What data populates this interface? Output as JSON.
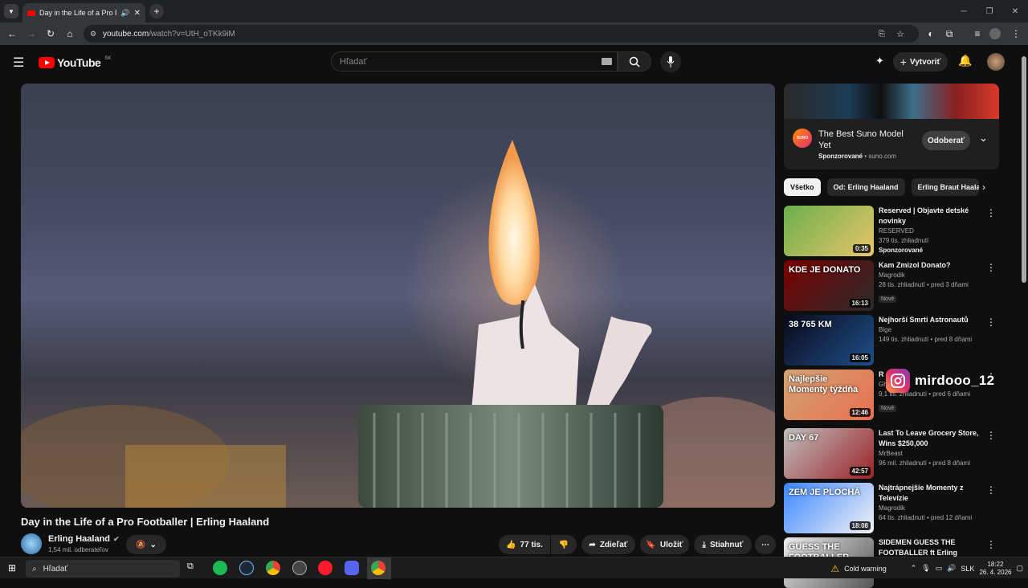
{
  "browser": {
    "tab_title": "Day in the Life of a Pro Footb",
    "url_host": "youtube.com",
    "url_path": "/watch?v=UtH_oTKk9iM"
  },
  "youtube": {
    "logo_text": "YouTube",
    "region": "SK",
    "search_placeholder": "Hľadať",
    "create_label": "Vytvoriť"
  },
  "video": {
    "title": "Day in the Life of a Pro Footballer | Erling Haaland",
    "channel": "Erling Haaland",
    "subscribers": "1,54 mil. odberateľov",
    "likes": "77 tis.",
    "share_label": "Zdieľať",
    "save_label": "Uložiť",
    "download_label": "Stiahnuť"
  },
  "ad": {
    "logo_text": "SUNO",
    "title": "The Best Suno Model Yet",
    "sponsored": "Sponzorované",
    "domain": "suno.com",
    "button": "Odoberať"
  },
  "chips": [
    "Všetko",
    "Od: Erling Haaland",
    "Erling Braut Haala"
  ],
  "recommendations": [
    {
      "title": "Reserved | Objavte detské novinky",
      "channel": "RESERVED",
      "meta": "379 tis. zhliadnutí",
      "extra": "Sponzorované",
      "duration": "0:35",
      "colors": [
        "#6ab04c",
        "#e9c46a"
      ]
    },
    {
      "title": "Kam Zmizol Donato?",
      "channel": "Magrodik",
      "meta": "28 tis. zhliadnutí • pred 3 dňami",
      "extra": "Nové",
      "duration": "16:13",
      "colors": [
        "#7a0000",
        "#2b2b2b"
      ],
      "thumb_text": "KDE JE DONATO"
    },
    {
      "title": "Nejhorší Smrti Astronautů",
      "channel": "Bige",
      "meta": "149 tis. zhliadnutí • pred 8 dňami",
      "extra": "",
      "duration": "16:05",
      "colors": [
        "#0a0a1a",
        "#1e4f8a"
      ],
      "thumb_text": "38 765 KM"
    },
    {
      "title": "R",
      "channel": "Ghuss",
      "meta": "9,1 tis. zhliadnutí • pred 6 dňami",
      "extra": "Nové",
      "duration": "12:46",
      "colors": [
        "#d4a373",
        "#e76f51"
      ],
      "thumb_text": "Najlepšie Momenty týždňa"
    },
    {
      "title": "Last To Leave Grocery Store, Wins $250,000",
      "channel": "MrBeast",
      "meta": "96 mil. zhliadnutí • pred 8 dňami",
      "extra": "",
      "duration": "42:57",
      "colors": [
        "#c0c0c0",
        "#9b2226"
      ],
      "thumb_text": "DAY 67"
    },
    {
      "title": "Najtrápnejšie Momenty z Televízie",
      "channel": "Magrodik",
      "meta": "64 tis. zhliadnutí • pred 12 dňami",
      "extra": "",
      "duration": "18:08",
      "colors": [
        "#3a86ff",
        "#f4f4f4"
      ],
      "thumb_text": "ZEM JE PLOCHÁ"
    },
    {
      "title": "SIDEMEN GUESS THE FOOTBALLER ft Erling Haaland",
      "channel": "",
      "meta": "",
      "extra": "",
      "duration": "",
      "colors": [
        "#eeeeee",
        "#555555"
      ],
      "thumb_text": "GUESS THE FOOTBALLER"
    }
  ],
  "overlay": {
    "instagram_handle": "mirdooo_12"
  },
  "taskbar": {
    "search_placeholder": "Hľadať",
    "weather": "Cold warning",
    "lang": "SLK",
    "time": "18:22",
    "date": "26. 4. 2026"
  }
}
